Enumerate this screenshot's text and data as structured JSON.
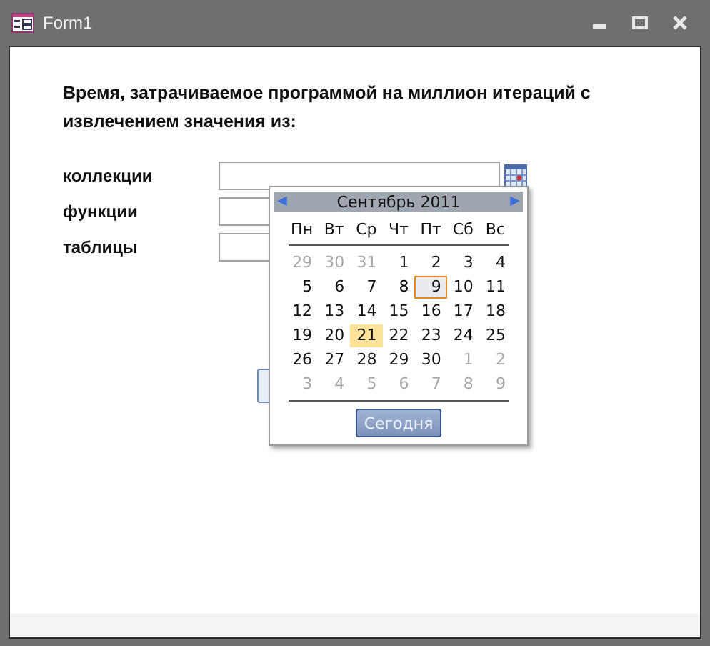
{
  "window": {
    "title": "Form1"
  },
  "heading": "Время, затрачиваемое программой на миллион итераций с извлечением значения из:",
  "fields": [
    {
      "label": "коллекции",
      "calendar_button": true
    },
    {
      "label": "функции",
      "calendar_button": false
    },
    {
      "label": "таблицы",
      "calendar_button": false
    }
  ],
  "calendar": {
    "prev": "◀",
    "next": "▶",
    "month": "Сентябрь 2011",
    "weekdays": [
      "Пн",
      "Вт",
      "Ср",
      "Чт",
      "Пт",
      "Сб",
      "Вс"
    ],
    "weeks": [
      [
        {
          "day": "29",
          "other_month": true,
          "selected": false,
          "today": false
        },
        {
          "day": "30",
          "other_month": true,
          "selected": false,
          "today": false
        },
        {
          "day": "31",
          "other_month": true,
          "selected": false,
          "today": false
        },
        {
          "day": "1",
          "other_month": false,
          "selected": false,
          "today": false
        },
        {
          "day": "2",
          "other_month": false,
          "selected": false,
          "today": false
        },
        {
          "day": "3",
          "other_month": false,
          "selected": false,
          "today": false
        },
        {
          "day": "4",
          "other_month": false,
          "selected": false,
          "today": false
        }
      ],
      [
        {
          "day": "5",
          "other_month": false,
          "selected": false,
          "today": false
        },
        {
          "day": "6",
          "other_month": false,
          "selected": false,
          "today": false
        },
        {
          "day": "7",
          "other_month": false,
          "selected": false,
          "today": false
        },
        {
          "day": "8",
          "other_month": false,
          "selected": false,
          "today": false
        },
        {
          "day": "9",
          "other_month": false,
          "selected": false,
          "today": true
        },
        {
          "day": "10",
          "other_month": false,
          "selected": false,
          "today": false
        },
        {
          "day": "11",
          "other_month": false,
          "selected": false,
          "today": false
        }
      ],
      [
        {
          "day": "12",
          "other_month": false,
          "selected": false,
          "today": false
        },
        {
          "day": "13",
          "other_month": false,
          "selected": false,
          "today": false
        },
        {
          "day": "14",
          "other_month": false,
          "selected": false,
          "today": false
        },
        {
          "day": "15",
          "other_month": false,
          "selected": false,
          "today": false
        },
        {
          "day": "16",
          "other_month": false,
          "selected": false,
          "today": false
        },
        {
          "day": "17",
          "other_month": false,
          "selected": false,
          "today": false
        },
        {
          "day": "18",
          "other_month": false,
          "selected": false,
          "today": false
        }
      ],
      [
        {
          "day": "19",
          "other_month": false,
          "selected": false,
          "today": false
        },
        {
          "day": "20",
          "other_month": false,
          "selected": false,
          "today": false
        },
        {
          "day": "21",
          "other_month": false,
          "selected": true,
          "today": false
        },
        {
          "day": "22",
          "other_month": false,
          "selected": false,
          "today": false
        },
        {
          "day": "23",
          "other_month": false,
          "selected": false,
          "today": false
        },
        {
          "day": "24",
          "other_month": false,
          "selected": false,
          "today": false
        },
        {
          "day": "25",
          "other_month": false,
          "selected": false,
          "today": false
        }
      ],
      [
        {
          "day": "26",
          "other_month": false,
          "selected": false,
          "today": false
        },
        {
          "day": "27",
          "other_month": false,
          "selected": false,
          "today": false
        },
        {
          "day": "28",
          "other_month": false,
          "selected": false,
          "today": false
        },
        {
          "day": "29",
          "other_month": false,
          "selected": false,
          "today": false
        },
        {
          "day": "30",
          "other_month": false,
          "selected": false,
          "today": false
        },
        {
          "day": "1",
          "other_month": true,
          "selected": false,
          "today": false
        },
        {
          "day": "2",
          "other_month": true,
          "selected": false,
          "today": false
        }
      ],
      [
        {
          "day": "3",
          "other_month": true,
          "selected": false,
          "today": false
        },
        {
          "day": "4",
          "other_month": true,
          "selected": false,
          "today": false
        },
        {
          "day": "5",
          "other_month": true,
          "selected": false,
          "today": false
        },
        {
          "day": "6",
          "other_month": true,
          "selected": false,
          "today": false
        },
        {
          "day": "7",
          "other_month": true,
          "selected": false,
          "today": false
        },
        {
          "day": "8",
          "other_month": true,
          "selected": false,
          "today": false
        },
        {
          "day": "9",
          "other_month": true,
          "selected": false,
          "today": false
        }
      ]
    ],
    "today_button": "Сегодня"
  }
}
